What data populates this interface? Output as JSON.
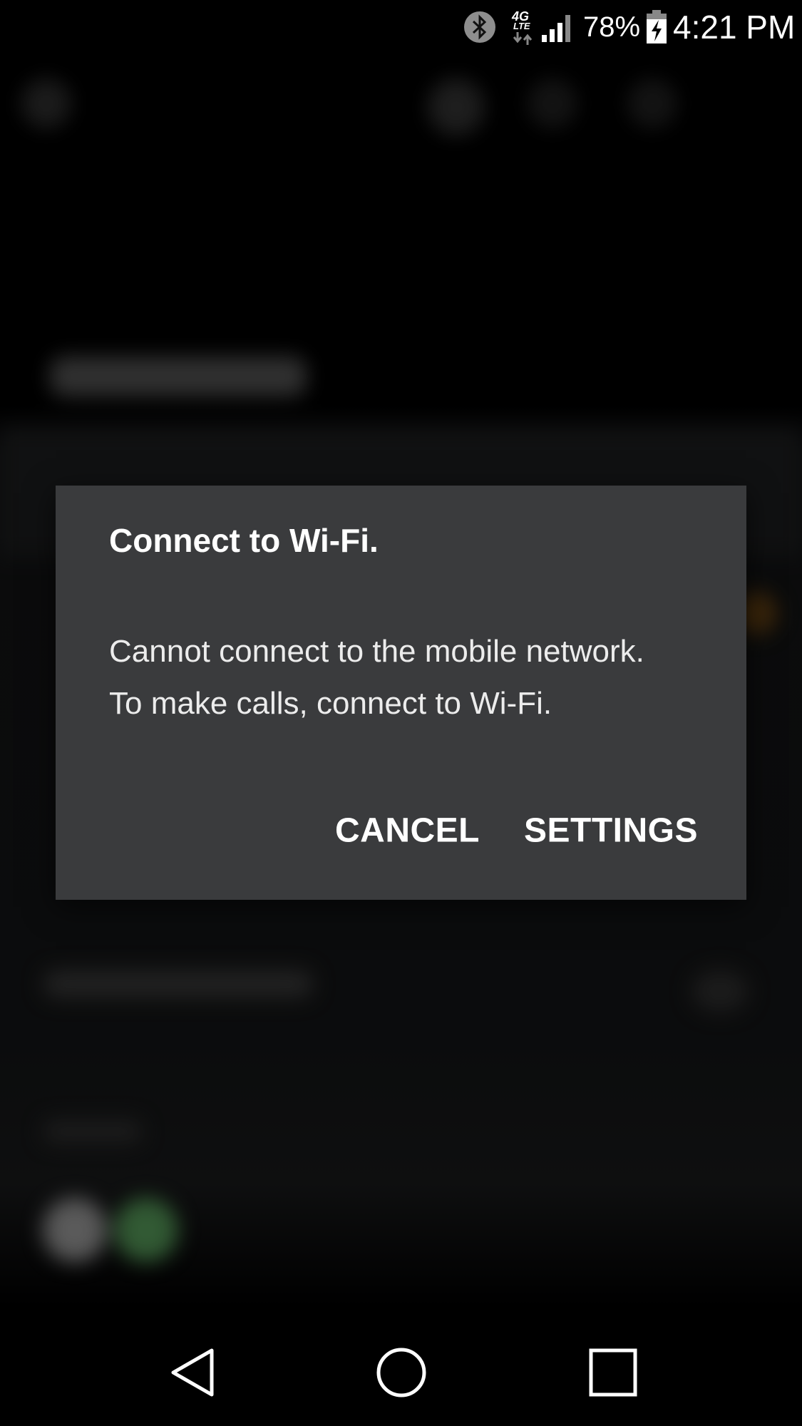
{
  "status_bar": {
    "icons": [
      "bluetooth-icon",
      "4g-lte-icon",
      "signal-icon",
      "battery-charging-icon"
    ],
    "network_label_top": "4G",
    "network_label_bottom": "LTE",
    "battery_percent": "78%",
    "time": "4:21 PM"
  },
  "dialog": {
    "title": "Connect to Wi-Fi.",
    "message": "Cannot connect to the mobile network. To make calls, connect to Wi-Fi.",
    "cancel_label": "CANCEL",
    "settings_label": "SETTINGS"
  },
  "nav_bar": {
    "icons": [
      "back-icon",
      "home-icon",
      "recents-icon"
    ]
  }
}
